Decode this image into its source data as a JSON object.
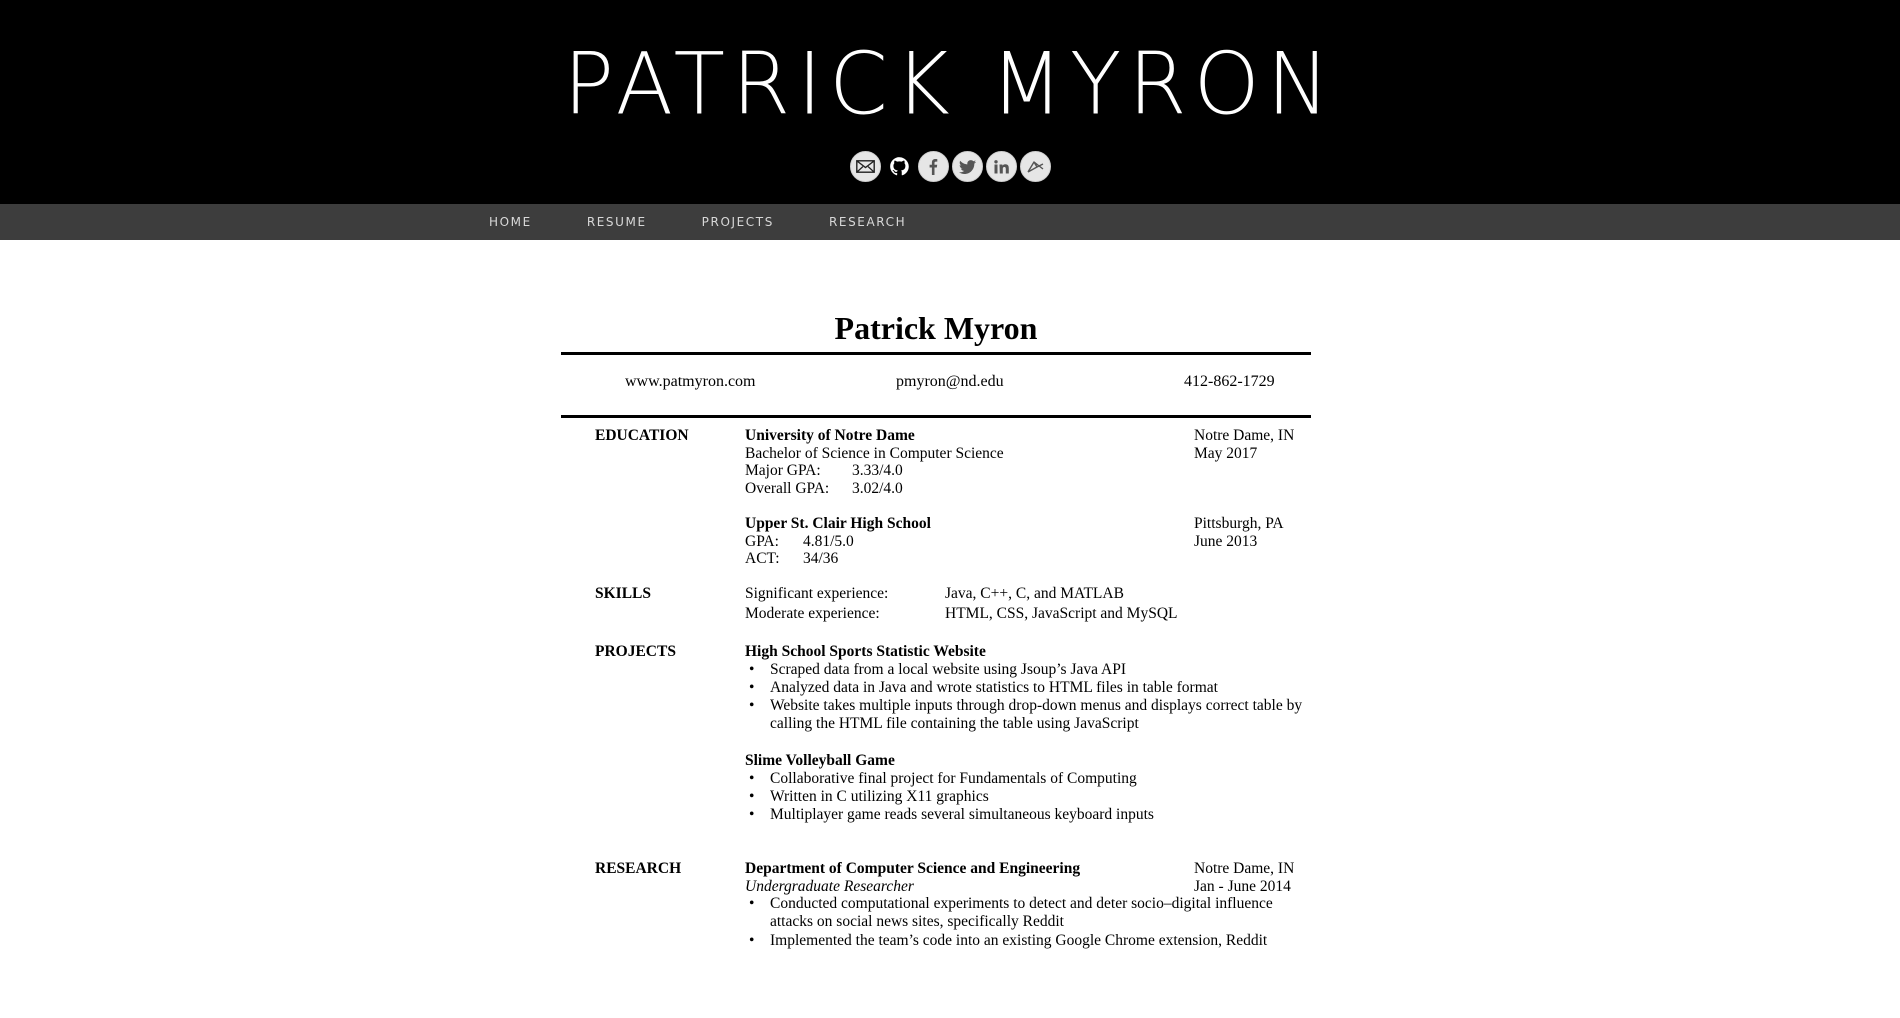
{
  "header": {
    "site_title": "PATRICK MYRON",
    "social_icons": [
      "email-icon",
      "github-icon",
      "facebook-icon",
      "twitter-icon",
      "linkedin-icon",
      "codepen-icon"
    ]
  },
  "nav": {
    "items": [
      "HOME",
      "RESUME",
      "PROJECTS",
      "RESEARCH"
    ]
  },
  "resume": {
    "name": "Patrick Myron",
    "website": "www.patmyron.com",
    "email": "pmyron@nd.edu",
    "phone": "412-862-1729",
    "education": {
      "label": "EDUCATION",
      "schools": [
        {
          "name": "University of Notre Dame",
          "degree": "Bachelor of Science in Computer Science",
          "lines": [
            {
              "k": "Major GPA:",
              "v": "3.33/4.0"
            },
            {
              "k": "Overall GPA:",
              "v": "3.02/4.0"
            }
          ],
          "location": "Notre Dame, IN",
          "date": "May 2017"
        },
        {
          "name": "Upper St. Clair High School",
          "lines": [
            {
              "k": "GPA:",
              "v": "4.81/5.0"
            },
            {
              "k": "ACT:",
              "v": "34/36"
            }
          ],
          "location": "Pittsburgh, PA",
          "date": "June 2013"
        }
      ]
    },
    "skills": {
      "label": "SKILLS",
      "rows": [
        {
          "k": "Significant experience:",
          "v": "Java, C++, C, and MATLAB"
        },
        {
          "k": "Moderate experience:",
          "v": "HTML, CSS, JavaScript and MySQL"
        }
      ]
    },
    "projects": {
      "label": "PROJECTS",
      "items": [
        {
          "title": "High School Sports Statistic Website",
          "bullets": [
            "Scraped data from a local website using Jsoup’s Java API",
            "Analyzed data in Java and wrote statistics to HTML files in table format",
            "Website takes multiple inputs through drop-down menus and displays correct table by calling the HTML file containing the table using JavaScript"
          ]
        },
        {
          "title": "Slime Volleyball Game",
          "bullets": [
            "Collaborative final project for Fundamentals of Computing",
            "Written in C utilizing X11 graphics",
            "Multiplayer game reads several simultaneous keyboard inputs"
          ]
        }
      ]
    },
    "research": {
      "label": "RESEARCH",
      "org": "Department of Computer Science and Engineering",
      "role": "Undergraduate Researcher",
      "location": "Notre Dame, IN",
      "date": "Jan - June 2014",
      "bullets": [
        "Conducted computational experiments to detect and deter socio–digital influence attacks on social news sites, specifically Reddit",
        "Implemented the team’s code into an existing Google Chrome extension, Reddit"
      ]
    }
  }
}
